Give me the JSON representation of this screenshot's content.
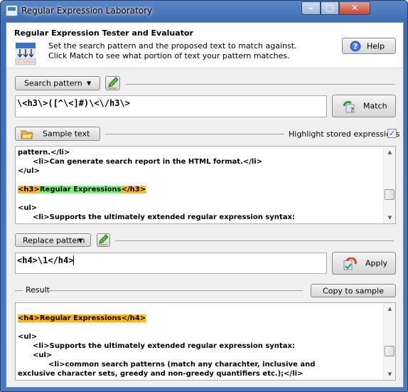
{
  "window": {
    "title": "Regular Expression Laboratory",
    "controls": {
      "minimize": "minimize",
      "maximize": "maximize",
      "close": "close"
    }
  },
  "header": {
    "title": "Regular Expression Tester and Evaluator",
    "description_line1": "Set the search pattern and the proposed text to match against.",
    "description_line2": "Click Match to see what portion of text your pattern matches.",
    "help_label": "Help"
  },
  "search": {
    "dropdown_label": "Search pattern",
    "value": "\\<h3\\>([^\\<]#)\\<\\/h3\\>",
    "match_label": "Match"
  },
  "sample": {
    "button_label": "Sample text",
    "highlight_label": "Highlight stored expressions",
    "highlight_checked": true,
    "lines": [
      {
        "indent": 0,
        "text": "pattern.</li>"
      },
      {
        "indent": 1,
        "text": "<li>Can generate search report in the HTML format.</li>"
      },
      {
        "indent": 0,
        "text": "</ul>"
      },
      {
        "indent": 0,
        "text": ""
      },
      {
        "indent": 0,
        "match_open": "<h3>",
        "match_group": "Regular Expressions",
        "match_close": "</h3>"
      },
      {
        "indent": 0,
        "text": ""
      },
      {
        "indent": 0,
        "text": "<ul>"
      },
      {
        "indent": 1,
        "text": "<li>Supports the ultimately extended regular expression syntax:"
      }
    ]
  },
  "replace": {
    "dropdown_label": "Replace pattern",
    "value": "<h4>\\1</h4>",
    "apply_label": "Apply"
  },
  "result": {
    "label": "Result",
    "copy_label": "Copy to sample",
    "lines": [
      {
        "indent": 0,
        "text": ""
      },
      {
        "indent": 0,
        "highlight": "<h4>Regular Expressions</h4>"
      },
      {
        "indent": 0,
        "text": ""
      },
      {
        "indent": 0,
        "text": "<ul>"
      },
      {
        "indent": 1,
        "text": "<li>Supports the ultimately extended regular expression syntax:"
      },
      {
        "indent": 1,
        "text": "<ul>"
      },
      {
        "indent": 2,
        "text": "<li>common search patterns (match any charachter, inclusive and"
      },
      {
        "indent": 0,
        "text": "exclusive character sets, greedy and non-greedy quantifiers etc.);</li>"
      }
    ]
  },
  "colors": {
    "match_highlight": "#ffb61e",
    "group_highlight": "#66ff66",
    "titlebar": "#4a7bc0"
  }
}
